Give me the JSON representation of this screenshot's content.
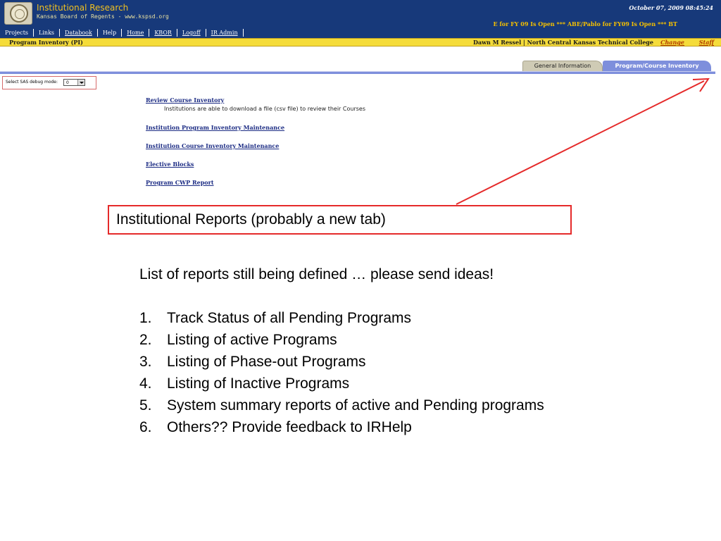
{
  "header": {
    "title": "Institutional Research",
    "subtitle": "Kansas Board of Regents - www.kspsd.org",
    "datetime": "October 07, 2009 08:45:24",
    "ticker": "E for FY 09 Is Open *** ABE/Pablo for FY09  Is Open *** BT"
  },
  "nav": {
    "items": [
      {
        "label": "Projects"
      },
      {
        "label": "Links"
      },
      {
        "label": "Databook"
      },
      {
        "label": "Help"
      },
      {
        "label": "Home"
      },
      {
        "label": "KBOR"
      },
      {
        "label": "Logoff"
      },
      {
        "label": "IR Admin"
      }
    ]
  },
  "status_bar": {
    "page_name": "Program Inventory (PI)",
    "user_info": "Dawn M Ressel  | North Central Kansas Technical College",
    "change_label": "Change",
    "staff_label": "Staff"
  },
  "tabs": {
    "general": "General Information",
    "program": "Program/Course Inventory"
  },
  "debug": {
    "label": "Select SAS debug mode:",
    "value": "0"
  },
  "links": {
    "review": "Review Course Inventory",
    "review_desc": "Institutions are able to download a file (csv file) to review their Courses",
    "program_maint": "Institution Program Inventory Maintenance",
    "course_maint": "Institution Course Inventory Maintenance",
    "elective": "Elective Blocks",
    "cwp": "Program CWP Report"
  },
  "annotation": {
    "callout": "Institutional Reports (probably a new tab)",
    "accent_color": "#e52a2a"
  },
  "notes": {
    "intro": "List of reports still being defined … please send ideas!",
    "items": [
      {
        "num": "1.",
        "text": "Track Status of all Pending Programs"
      },
      {
        "num": "2.",
        "text": "Listing of active Programs"
      },
      {
        "num": "3.",
        "text": "Listing of Phase-out Programs"
      },
      {
        "num": "4.",
        "text": "Listing of Inactive Programs"
      },
      {
        "num": "5.",
        "text": "System summary reports of active and Pending programs"
      },
      {
        "num": "6.",
        "text": "Others?? Provide feedback to IRHelp"
      }
    ]
  },
  "colors": {
    "header_bg": "#17397a",
    "title_gold": "#f0c020",
    "status_yellow": "#f5dc3a",
    "tab_active": "#7e8fdc",
    "link_blue": "#1c2c84"
  }
}
